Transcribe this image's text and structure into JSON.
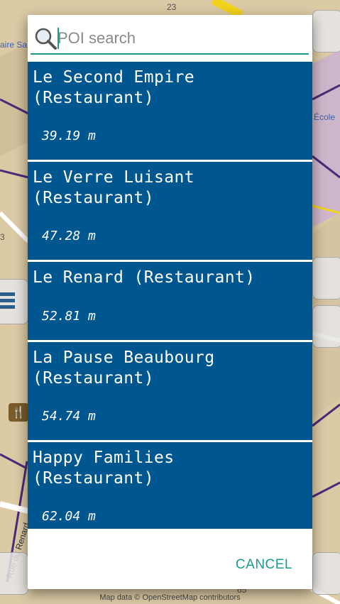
{
  "map": {
    "labels": {
      "top_left": "aire Sa",
      "top_number": "23",
      "right_label": "École",
      "left_number": "3",
      "street": "Rue du Renard",
      "bottom_number": "65"
    },
    "attribution": "Map data © OpenStreetMap contributors",
    "colors": {
      "land": "#d9c9a8",
      "road_purple": "#4a2a7a",
      "road_yellow": "#f2d21a",
      "building": "#c8b99a"
    }
  },
  "search": {
    "placeholder": "POI search",
    "value": "",
    "icon": "search-icon"
  },
  "poi_results": [
    {
      "name": "Le Second Empire\n(Restaurant)",
      "distance": "39.19 m"
    },
    {
      "name": "Le Verre Luisant\n(Restaurant)",
      "distance": "47.28 m"
    },
    {
      "name": "Le Renard (Restaurant)",
      "distance": "52.81 m"
    },
    {
      "name": "La Pause Beaubourg\n(Restaurant)",
      "distance": "54.74 m"
    },
    {
      "name": "Happy Families\n(Restaurant)",
      "distance": "62.04 m"
    }
  ],
  "dialog": {
    "cancel_label": "CANCEL"
  },
  "colors": {
    "item_background": "#00568f",
    "accent": "#1a9c8c"
  }
}
